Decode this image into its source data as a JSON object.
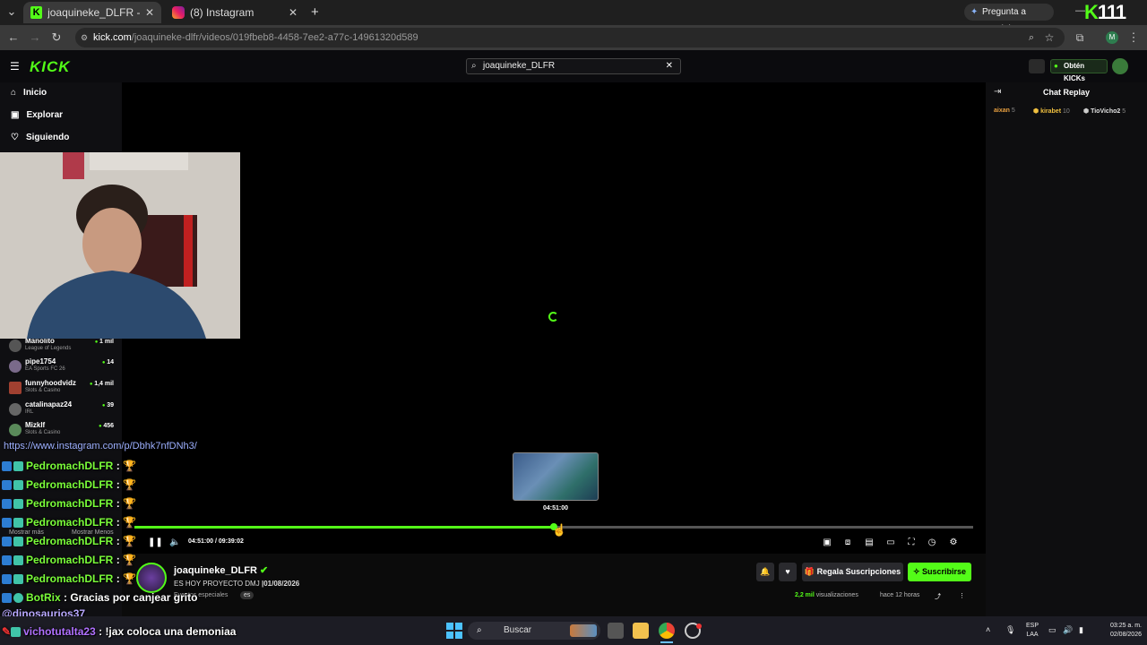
{
  "browser": {
    "tabs": [
      {
        "title": "joaquineke_DLFR - Watch the V",
        "close": "✕"
      },
      {
        "title": "(8) Instagram",
        "close": "✕"
      }
    ],
    "new_tab": "+",
    "url_host": "kick.com",
    "url_path": "/joaquineke-dlfr/videos/019fbeb8-4458-7ee2-a77c-14961320d589",
    "gemini_label": "Pregunta a Gemini",
    "profile_initial": "M",
    "overlay_logo_number": "111"
  },
  "kick": {
    "logo": "KICK",
    "search_value": "joaquineke_DLFR",
    "kicks_button": "Obtén KICKs",
    "nav": [
      {
        "label": "Inicio",
        "icon": "home-icon"
      },
      {
        "label": "Explorar",
        "icon": "explore-icon"
      },
      {
        "label": "Siguiendo",
        "icon": "heart-icon"
      }
    ],
    "channels": [
      {
        "name": "Manolito",
        "game": "League of Legends",
        "viewers": "1 mil"
      },
      {
        "name": "pipe1754",
        "game": "EA Sports FC 26",
        "viewers": "14"
      },
      {
        "name": "funnyhoodvidz",
        "game": "Slots & Casino",
        "viewers": "1,4 mil"
      },
      {
        "name": "catalinapaz24",
        "game": "IRL",
        "viewers": "39"
      },
      {
        "name": "Mizklf",
        "game": "Slots & Casino",
        "viewers": "456"
      }
    ],
    "sidebar_more": "Mostrar más",
    "sidebar_less": "Mostrar Menos"
  },
  "player": {
    "progress": 0.5,
    "hover_time": "04:51:00",
    "current_time": "04:51:00",
    "total_time": "09:39:02",
    "time_sep": "/"
  },
  "chat": {
    "title": "Chat Replay",
    "gifters": [
      {
        "name": "aixan",
        "count": "5",
        "color": "#e8a040"
      },
      {
        "name": "kirabet",
        "count": "10",
        "color": "#f0c040"
      },
      {
        "name": "TioVicho2",
        "count": "5",
        "color": "#e0e0e0"
      }
    ]
  },
  "stream": {
    "streamer": "joaquineke_DLFR",
    "title": "ES HOY PROYECTO DMJ",
    "date": "|01/08/2026",
    "category": "Eventos especiales",
    "language": "es",
    "gift_button": "Regala Suscripciones",
    "subscribe_button": "Suscribirse",
    "views_value": "2,2 mil",
    "views_label": "visualizaciones",
    "ago": "hace 12 horas"
  },
  "overlay_chat": {
    "link": "https://www.instagram.com/p/Dbhk7nfDNh3/",
    "repeated_user": "PedromachDLFR",
    "separator": ":",
    "botrix_user": "BotRix",
    "botrix_msg": ": Gracias por canjear grito",
    "mention": "@dinosaurios37",
    "last_user": "vichotutalta23",
    "last_msg": ": !jax coloca una demoniaa"
  },
  "taskbar": {
    "search": "Buscar",
    "lang_top": "ESP",
    "lang_bottom": "LAA",
    "time": "03:25 a. m.",
    "date": "02/08/2026"
  }
}
